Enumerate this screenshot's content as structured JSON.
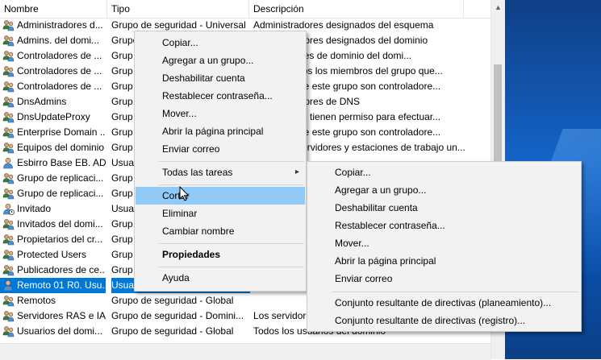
{
  "columns": {
    "name": "Nombre",
    "type": "Tipo",
    "description": "Descripción"
  },
  "rows": [
    {
      "name": "Administradores d...",
      "type": "Grupo de seguridad - Universal",
      "desc": "Administradores designados del esquema",
      "icon": "group"
    },
    {
      "name": "Admins. del domi...",
      "type": "Grupo",
      "desc": "Administradores designados del dominio",
      "icon": "group"
    },
    {
      "name": "Controladores de ...",
      "type": "Grup",
      "desc": "Controladores de dominio del domi...",
      "icon": "group"
    },
    {
      "name": "Controladores de ...",
      "type": "Grup",
      "desc": "Asignar todos los miembros del grupo que...",
      "icon": "group"
    },
    {
      "name": "Controladores de ...",
      "type": "Grup",
      "desc": "Miembros de este grupo son controladore...",
      "icon": "group"
    },
    {
      "name": "DnsAdmins",
      "type": "Grup",
      "desc": "Administradores de DNS",
      "icon": "group"
    },
    {
      "name": "DnsUpdateProxy",
      "type": "Grup",
      "desc": "Clientes que tienen permiso para efectuar...",
      "icon": "group"
    },
    {
      "name": "Enterprise Domain ...",
      "type": "Grup",
      "desc": "Miembros de este grupo son controladore...",
      "icon": "group"
    },
    {
      "name": "Equipos del dominio",
      "type": "Grup",
      "desc": "Todos los servidores y estaciones de trabajo un...",
      "icon": "group"
    },
    {
      "name": "Esbirro Base EB. AD",
      "type": "Usua",
      "desc": "",
      "icon": "user"
    },
    {
      "name": "Grupo de replicaci...",
      "type": "Grup",
      "desc": "",
      "icon": "group"
    },
    {
      "name": "Grupo de replicaci...",
      "type": "Grup",
      "desc": "",
      "icon": "group"
    },
    {
      "name": "Invitado",
      "type": "Usua",
      "desc": "",
      "icon": "user-disabled"
    },
    {
      "name": "Invitados del domi...",
      "type": "Grup",
      "desc": "",
      "icon": "group"
    },
    {
      "name": "Propietarios del cr...",
      "type": "Grup",
      "desc": "",
      "icon": "group"
    },
    {
      "name": "Protected Users",
      "type": "Grup",
      "desc": "",
      "icon": "group"
    },
    {
      "name": "Publicadores de ce...",
      "type": "Grup",
      "desc": "",
      "icon": "group"
    },
    {
      "name": "Remoto 01 R0. Usu...",
      "type": "Usuario",
      "desc": "",
      "icon": "user",
      "selected": true
    },
    {
      "name": "Remotos",
      "type": "Grupo de seguridad - Global",
      "desc": "",
      "icon": "group"
    },
    {
      "name": "Servidores RAS e IAS",
      "type": "Grupo de seguridad - Domini...",
      "desc": "Los servidores",
      "icon": "group"
    },
    {
      "name": "Usuarios del domi...",
      "type": "Grupo de seguridad - Global",
      "desc": "Todos los usuarios del dominio",
      "icon": "group"
    }
  ],
  "context_menu": {
    "copy": "Copiar...",
    "add_to_group": "Agregar a un grupo...",
    "disable": "Deshabilitar cuenta",
    "reset_password": "Restablecer contraseña...",
    "move": "Mover...",
    "open_home": "Abrir la página principal",
    "send_mail": "Enviar correo",
    "all_tasks": "Todas las tareas",
    "cut": "Cortar",
    "delete": "Eliminar",
    "rename": "Cambiar nombre",
    "properties": "Propiedades",
    "help": "Ayuda"
  },
  "submenu": {
    "copy": "Copiar...",
    "add_to_group": "Agregar a un grupo...",
    "disable": "Deshabilitar cuenta",
    "reset_password": "Restablecer contraseña...",
    "move": "Mover...",
    "open_home": "Abrir la página principal",
    "send_mail": "Enviar correo",
    "rsop_planning": "Conjunto resultante de directivas (planeamiento)...",
    "rsop_logging": "Conjunto resultante de directivas (registro)..."
  },
  "colors": {
    "selection": "#0078d7",
    "menu_highlight": "#91c9f7",
    "menu_bg": "#f2f2f2"
  }
}
